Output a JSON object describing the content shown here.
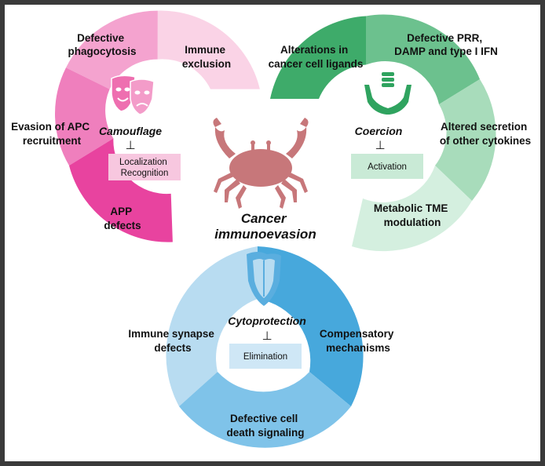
{
  "center": {
    "line1": "Cancer",
    "line2": "immunoevasion"
  },
  "mechanisms": {
    "camouflage": {
      "title": "Camouflage",
      "symbol": "⊥",
      "box_lines": [
        "Localization",
        "Recognition"
      ],
      "icon": "theater-masks-icon",
      "segments": [
        {
          "lines": [
            "Defective",
            "phagocytosis"
          ],
          "color": "#f4a3cf"
        },
        {
          "lines": [
            "Immune",
            "exclusion"
          ],
          "color": "#fad3e6"
        },
        {
          "lines": [
            "Evasion of APC",
            "recruitment"
          ],
          "color": "#ef7fbd"
        },
        {
          "lines": [
            "APP",
            "defects"
          ],
          "color": "#e8439f"
        }
      ]
    },
    "coercion": {
      "title": "Coercion",
      "symbol": "⊥",
      "box_lines": [
        "Activation"
      ],
      "icon": "hands-coins-icon",
      "segments": [
        {
          "lines": [
            "Alterations in",
            "cancer cell ligands"
          ],
          "color": "#3eab6a"
        },
        {
          "lines": [
            "Defective PRR,",
            "DAMP and type I IFN"
          ],
          "color": "#6cc18e"
        },
        {
          "lines": [
            "Altered secretion",
            "of other cytokines"
          ],
          "color": "#a8dcbb"
        },
        {
          "lines": [
            "Metabolic TME",
            "modulation"
          ],
          "color": "#d4efdf"
        }
      ]
    },
    "cytoprotection": {
      "title": "Cytoprotection",
      "symbol": "⊥",
      "box_lines": [
        "Elimination"
      ],
      "icon": "shield-icon",
      "segments": [
        {
          "lines": [
            "Immune synapse",
            "defects"
          ],
          "color": "#b8dcf1"
        },
        {
          "lines": [
            "Compensatory",
            "mechanisms"
          ],
          "color": "#47a8dc"
        },
        {
          "lines": [
            "Defective cell",
            "death signaling"
          ],
          "color": "#7fc3e9"
        }
      ]
    }
  },
  "colors": {
    "crab": "#c7777a",
    "masks": "#ee6fb0",
    "hands": "#2fa35f",
    "shield": "#5aaedf",
    "camouflage_box": "#f7c7df",
    "coercion_box": "#c9ead6",
    "cytoprotection_box": "#cfe7f6"
  }
}
